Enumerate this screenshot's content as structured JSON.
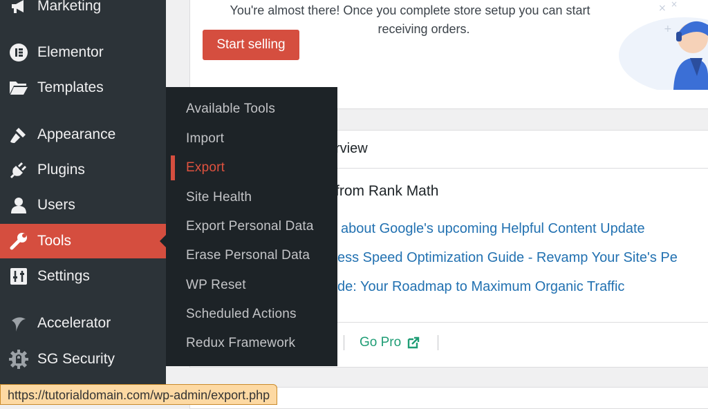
{
  "sidebar": {
    "items": [
      {
        "label": "Marketing",
        "icon": "megaphone-icon"
      },
      {
        "label": "Elementor",
        "icon": "elementor-icon"
      },
      {
        "label": "Templates",
        "icon": "folder-icon"
      },
      {
        "label": "Appearance",
        "icon": "paintbrush-icon"
      },
      {
        "label": "Plugins",
        "icon": "plugin-icon"
      },
      {
        "label": "Users",
        "icon": "user-icon"
      },
      {
        "label": "Tools",
        "icon": "wrench-icon"
      },
      {
        "label": "Settings",
        "icon": "settings-sliders-icon"
      },
      {
        "label": "Accelerator",
        "icon": "accelerator-icon"
      },
      {
        "label": "SG Security",
        "icon": "gear-lock-icon"
      }
    ],
    "active": "Tools"
  },
  "submenu": {
    "items": [
      "Available Tools",
      "Import",
      "Export",
      "Site Health",
      "Export Personal Data",
      "Erase Personal Data",
      "WP Reset",
      "Scheduled Actions",
      "Redux Framework"
    ],
    "current": "Export"
  },
  "setup": {
    "line1": "You're almost there! Once you complete store setup you can start",
    "line2": "receiving orders.",
    "button": "Start selling"
  },
  "overview": {
    "title_fragment": "rview",
    "news_heading": "from Rank Math",
    "links": [
      "about Google's upcoming Helpful Content Update",
      "ess Speed Optimization Guide - Revamp Your Site's Pe",
      "de: Your Roadmap to Maximum Organic Traffic"
    ],
    "go_pro": "Go Pro"
  },
  "status_bar": {
    "url": "https://tutorialdomain.com/wp-admin/export.php"
  },
  "colors": {
    "sidebar_bg": "#2c3338",
    "submenu_bg": "#1d2327",
    "accent": "#d54e3f",
    "link": "#2271b1",
    "go_pro": "#1f9d75"
  }
}
